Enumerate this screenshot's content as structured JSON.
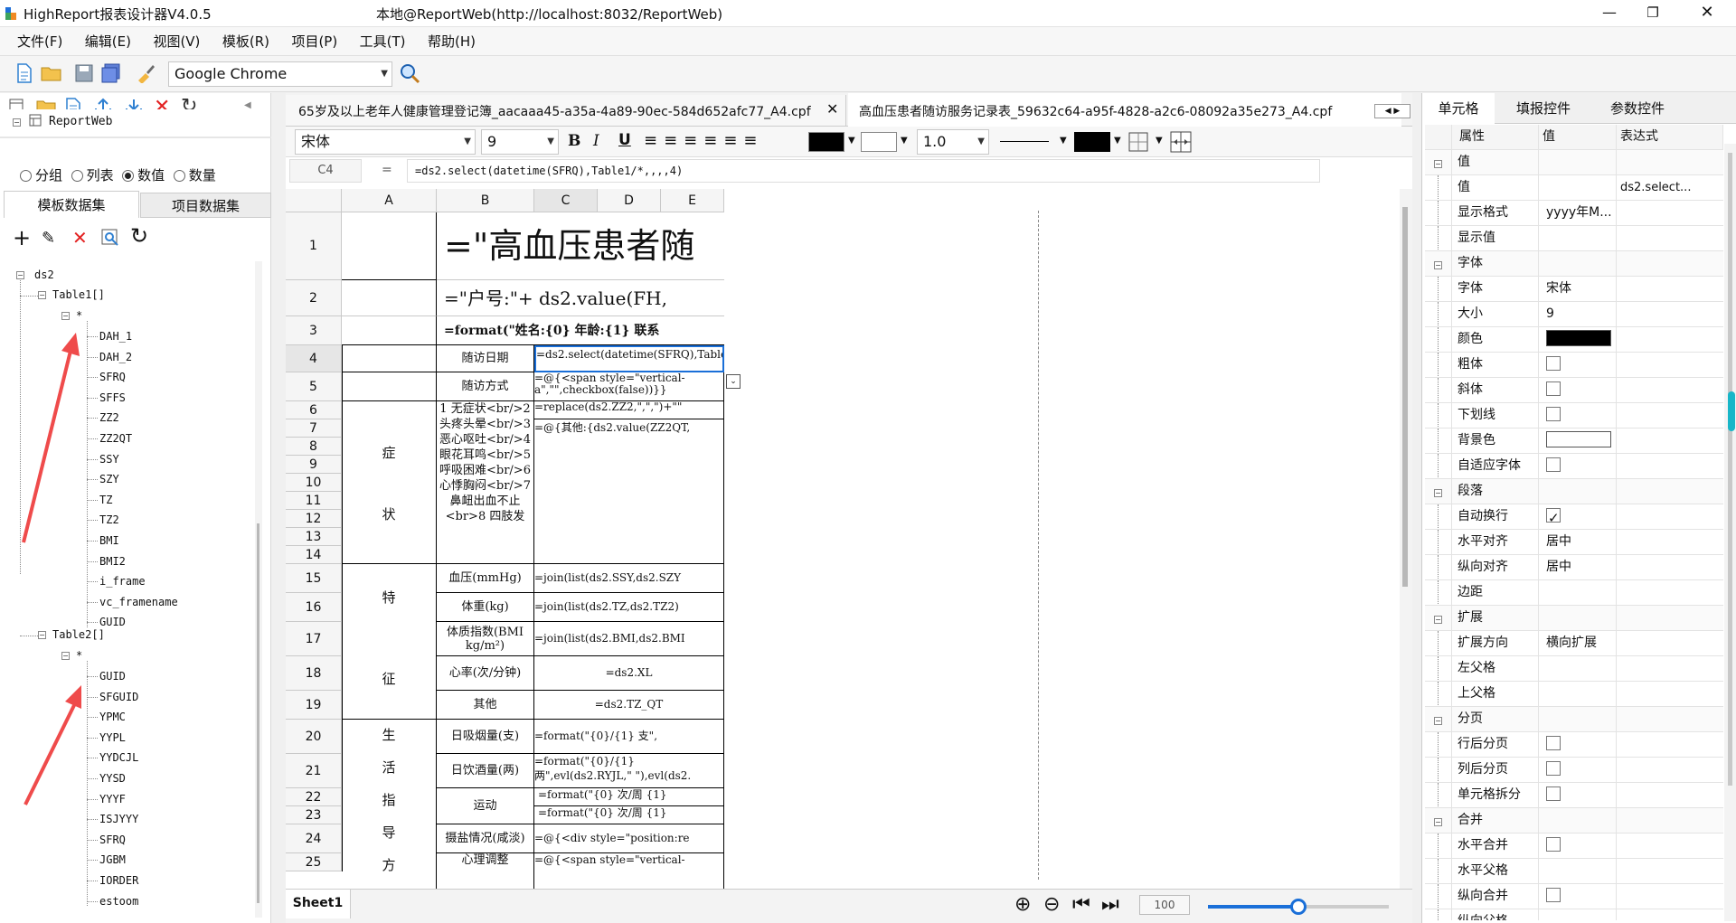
{
  "window": {
    "title": "HighReport报表设计器V4.0.5",
    "server": "本地@ReportWeb(http://localhost:8032/ReportWeb)"
  },
  "menu": [
    "文件(F)",
    "编辑(E)",
    "视图(V)",
    "模板(R)",
    "项目(P)",
    "工具(T)",
    "帮助(H)"
  ],
  "toolbar": {
    "browser": "Google Chrome"
  },
  "left": {
    "root": "ReportWeb",
    "modes": [
      {
        "label": "分组",
        "on": false
      },
      {
        "label": "列表",
        "on": false
      },
      {
        "label": "数值",
        "on": true
      },
      {
        "label": "数量",
        "on": false
      }
    ],
    "tabs": [
      "模板数据集",
      "项目数据集"
    ],
    "tree": {
      "ds": "ds2",
      "t1": "Table1[]",
      "t2": "Table2[]",
      "star": "*",
      "t1_fields": [
        "DAH_1",
        "DAH_2",
        "SFRQ",
        "SFFS",
        "ZZ2",
        "ZZ2QT",
        "SSY",
        "SZY",
        "TZ",
        "TZ2",
        "BMI",
        "BMI2",
        "i_frame",
        "vc_framename",
        "GUID"
      ],
      "t2_fields": [
        "GUID",
        "SFGUID",
        "YPMC",
        "YYPL",
        "YYDCJL",
        "YYSD",
        "YYYF",
        "ISJYYY",
        "SFRQ",
        "JGBM",
        "IORDER",
        "estoom"
      ]
    }
  },
  "tabs": [
    {
      "label": "65岁及以上老年人健康管理登记簿_aacaaa45-a35a-4a89-90ec-584d652afc77_A4.cpf",
      "active": false
    },
    {
      "label": "高血压患者随访服务记录表_59632c64-a95f-4828-a2c6-08092a35e273_A4.cpf",
      "active": true
    }
  ],
  "format": {
    "font": "宋体",
    "size": "9",
    "line": "1.0"
  },
  "formula": {
    "cell": "C4",
    "eq": "=",
    "expr": "=ds2.select(datetime(SFRQ),Table1/*,,,,4)"
  },
  "grid": {
    "cols": [
      "A",
      "B",
      "C",
      "D",
      "E"
    ],
    "rows": [
      "1",
      "2",
      "3",
      "4",
      "5",
      "6",
      "7",
      "8",
      "9",
      "10",
      "11",
      "12",
      "13",
      "14",
      "15",
      "16",
      "17",
      "18",
      "19",
      "20",
      "21",
      "22",
      "23",
      "24",
      "25"
    ],
    "cells": {
      "r1": "=\"高血压患者随",
      "r2": "=\"户号:\"+ ds2.value(FH,",
      "r3": "=format(\"姓名:{0}   年龄:{1}   联系",
      "b4": "随访日期",
      "c4": "=ds2.select(datetime(SFRQ),Table1/*,,,,4)",
      "b5": "随访方式",
      "c5": "=@{<span style=\"vertical-a\",\"\",checkbox(false))}}",
      "a_zz1": "症",
      "a_zz2": "状",
      "b6": "1 无症状<br/>2 头疼头晕<br/>3 恶心呕吐<br/>4 眼花耳鸣<br/>5 呼吸困难<br/>6 心悸胸闷<br/>7 鼻衄出血不止<br>8 四肢发",
      "c6": "=replace(ds2.ZZ2,\",\",\")+\"\"",
      "c7": "=@{其他:{ds2.value(ZZ2QT,",
      "a_tz1": "特",
      "a_tz2": "征",
      "b15": "血压(mmHg)",
      "c15": "=join(list(ds2.SSY,ds2.SZY",
      "b16": "体重(kg)",
      "c16": "=join(list(ds2.TZ,ds2.TZ2)",
      "b17": "体质指数(BMI kg/m²)",
      "c17": "=join(list(ds2.BMI,ds2.BMI",
      "b18": "心率(次/分钟)",
      "c18": "=ds2.XL",
      "b19": "其他",
      "c19": "=ds2.TZ_QT",
      "a_sh": [
        "生",
        "活",
        "指",
        "导",
        "方"
      ],
      "b20": "日吸烟量(支)",
      "c20": "=format(\"{0}/{1}        支\",",
      "b21": "日饮酒量(两)",
      "c21": "=format(\"{0}/{1}        两\",evl(ds2.RYJL,\"  \"),evl(ds2.",
      "b22": "运动",
      "c22": "=format(\"{0} 次/周      {1}",
      "c23": "=format(\"{0} 次/周      {1}",
      "b24": "摄盐情况(咸淡)",
      "c24": "=@{<div style=\"position:re",
      "b25": "心理调整",
      "c25": "=@{<span style=\"vertical-"
    },
    "sheet": "Sheet1",
    "zoom": "100",
    "zoom_level": 0.5
  },
  "right": {
    "tabs": [
      "单元格",
      "填报控件",
      "参数控件"
    ],
    "headers": [
      "属性",
      "值",
      "表达式"
    ],
    "groups": [
      {
        "name": "值",
        "props": [
          {
            "k": "值",
            "v": "",
            "e": "ds2.select..."
          },
          {
            "k": "显示格式",
            "v": "yyyy年M...",
            "e": ""
          },
          {
            "k": "显示值",
            "v": "",
            "e": ""
          }
        ]
      },
      {
        "name": "字体",
        "props": [
          {
            "k": "字体",
            "v": "宋体"
          },
          {
            "k": "大小",
            "v": "9"
          },
          {
            "k": "颜色",
            "type": "color",
            "color": "#000000"
          },
          {
            "k": "粗体",
            "type": "cb"
          },
          {
            "k": "斜体",
            "type": "cb"
          },
          {
            "k": "下划线",
            "type": "cb"
          },
          {
            "k": "背景色",
            "type": "color",
            "color": "#ffffff"
          },
          {
            "k": "自适应字体",
            "type": "cb"
          }
        ]
      },
      {
        "name": "段落",
        "props": [
          {
            "k": "自动换行",
            "type": "cb",
            "on": true
          },
          {
            "k": "水平对齐",
            "v": "居中"
          },
          {
            "k": "纵向对齐",
            "v": "居中"
          },
          {
            "k": "边距",
            "v": ""
          }
        ]
      },
      {
        "name": "扩展",
        "props": [
          {
            "k": "扩展方向",
            "v": "横向扩展"
          },
          {
            "k": "左父格",
            "v": ""
          },
          {
            "k": "上父格",
            "v": ""
          }
        ]
      },
      {
        "name": "分页",
        "props": [
          {
            "k": "行后分页",
            "type": "cb"
          },
          {
            "k": "列后分页",
            "type": "cb"
          },
          {
            "k": "单元格拆分",
            "type": "cb"
          }
        ]
      },
      {
        "name": "合并",
        "props": [
          {
            "k": "水平合并",
            "type": "cb"
          },
          {
            "k": "水平父格",
            "v": ""
          },
          {
            "k": "纵向合并",
            "type": "cb"
          },
          {
            "k": "纵向父格",
            "v": ""
          }
        ]
      }
    ]
  }
}
